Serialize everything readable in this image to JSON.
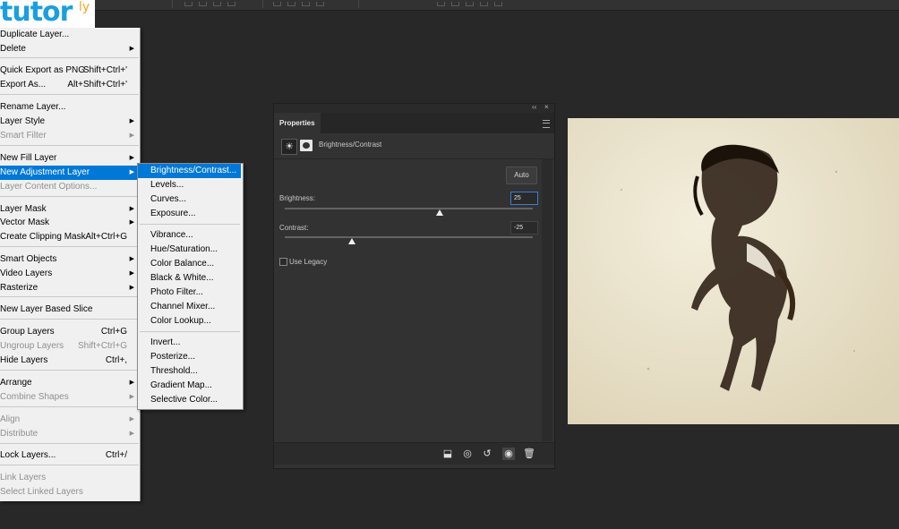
{
  "logo": {
    "text": "tutor",
    "sup": "ly"
  },
  "menu": {
    "items": [
      {
        "label": "Duplicate Layer...",
        "shortcut": "",
        "arrow": false,
        "disabled": false,
        "highlight": false
      },
      {
        "label": "Delete",
        "shortcut": "",
        "arrow": true,
        "disabled": false,
        "highlight": false
      },
      {
        "label": "Quick Export as PNG",
        "shortcut": "Shift+Ctrl+'",
        "arrow": false,
        "disabled": false,
        "highlight": false
      },
      {
        "label": "Export As...",
        "shortcut": "Alt+Shift+Ctrl+'",
        "arrow": false,
        "disabled": false,
        "highlight": false
      },
      {
        "label": "Rename Layer...",
        "shortcut": "",
        "arrow": false,
        "disabled": false,
        "highlight": false
      },
      {
        "label": "Layer Style",
        "shortcut": "",
        "arrow": true,
        "disabled": false,
        "highlight": false
      },
      {
        "label": "Smart Filter",
        "shortcut": "",
        "arrow": true,
        "disabled": true,
        "highlight": false
      },
      {
        "label": "New Fill Layer",
        "shortcut": "",
        "arrow": true,
        "disabled": false,
        "highlight": false
      },
      {
        "label": "New Adjustment Layer",
        "shortcut": "",
        "arrow": true,
        "disabled": false,
        "highlight": true
      },
      {
        "label": "Layer Content Options...",
        "shortcut": "",
        "arrow": false,
        "disabled": true,
        "highlight": false
      },
      {
        "label": "Layer Mask",
        "shortcut": "",
        "arrow": true,
        "disabled": false,
        "highlight": false
      },
      {
        "label": "Vector Mask",
        "shortcut": "",
        "arrow": true,
        "disabled": false,
        "highlight": false
      },
      {
        "label": "Create Clipping Mask",
        "shortcut": "Alt+Ctrl+G",
        "arrow": false,
        "disabled": false,
        "highlight": false
      },
      {
        "label": "Smart Objects",
        "shortcut": "",
        "arrow": true,
        "disabled": false,
        "highlight": false
      },
      {
        "label": "Video Layers",
        "shortcut": "",
        "arrow": true,
        "disabled": false,
        "highlight": false
      },
      {
        "label": "Rasterize",
        "shortcut": "",
        "arrow": true,
        "disabled": false,
        "highlight": false
      },
      {
        "label": "New Layer Based Slice",
        "shortcut": "",
        "arrow": false,
        "disabled": false,
        "highlight": false
      },
      {
        "label": "Group Layers",
        "shortcut": "Ctrl+G",
        "arrow": false,
        "disabled": false,
        "highlight": false
      },
      {
        "label": "Ungroup Layers",
        "shortcut": "Shift+Ctrl+G",
        "arrow": false,
        "disabled": true,
        "highlight": false
      },
      {
        "label": "Hide Layers",
        "shortcut": "Ctrl+,",
        "arrow": false,
        "disabled": false,
        "highlight": false
      },
      {
        "label": "Arrange",
        "shortcut": "",
        "arrow": true,
        "disabled": false,
        "highlight": false
      },
      {
        "label": "Combine Shapes",
        "shortcut": "",
        "arrow": true,
        "disabled": true,
        "highlight": false
      },
      {
        "label": "Align",
        "shortcut": "",
        "arrow": true,
        "disabled": true,
        "highlight": false
      },
      {
        "label": "Distribute",
        "shortcut": "",
        "arrow": true,
        "disabled": true,
        "highlight": false
      },
      {
        "label": "Lock Layers...",
        "shortcut": "Ctrl+/",
        "arrow": false,
        "disabled": false,
        "highlight": false
      },
      {
        "label": "Link Layers",
        "shortcut": "",
        "arrow": false,
        "disabled": true,
        "highlight": false
      },
      {
        "label": "Select Linked Layers",
        "shortcut": "",
        "arrow": false,
        "disabled": true,
        "highlight": false
      }
    ]
  },
  "submenu": {
    "items": [
      {
        "label": "Brightness/Contrast...",
        "highlight": true
      },
      {
        "label": "Levels...",
        "highlight": false
      },
      {
        "label": "Curves...",
        "highlight": false
      },
      {
        "label": "Exposure...",
        "highlight": false
      },
      {
        "label": "Vibrance...",
        "highlight": false
      },
      {
        "label": "Hue/Saturation...",
        "highlight": false
      },
      {
        "label": "Color Balance...",
        "highlight": false
      },
      {
        "label": "Black & White...",
        "highlight": false
      },
      {
        "label": "Photo Filter...",
        "highlight": false
      },
      {
        "label": "Channel Mixer...",
        "highlight": false
      },
      {
        "label": "Color Lookup...",
        "highlight": false
      },
      {
        "label": "Invert...",
        "highlight": false
      },
      {
        "label": "Posterize...",
        "highlight": false
      },
      {
        "label": "Threshold...",
        "highlight": false
      },
      {
        "label": "Gradient Map...",
        "highlight": false
      },
      {
        "label": "Selective Color...",
        "highlight": false
      }
    ]
  },
  "properties": {
    "tab": "Properties",
    "collapse_glyph": "‹‹",
    "close_glyph": "×",
    "adjustment_name": "Brightness/Contrast",
    "auto_label": "Auto",
    "brightness": {
      "label": "Brightness:",
      "value": "25",
      "level": 0.625
    },
    "contrast": {
      "label": "Contrast:",
      "value": "-25",
      "level": 0.27
    },
    "legacy_label": "Use Legacy"
  },
  "colors": {
    "menu_highlight": "#0078d7",
    "app_background": "#282828",
    "panel_background": "#323232"
  }
}
